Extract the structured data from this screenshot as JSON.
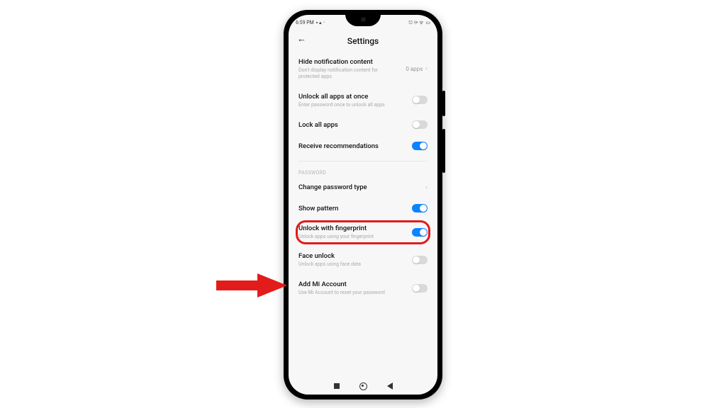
{
  "status": {
    "time": "6:59 PM",
    "icons_left": "▪ ▴ ··",
    "icons_right": "⎋ ⚞ ᯤ",
    "battery_icon": "▭"
  },
  "header": {
    "back_glyph": "←",
    "title": "Settings"
  },
  "rows": {
    "hide_notif": {
      "label": "Hide notification content",
      "sub": "Don't display notification content for protected apps",
      "count": "0 apps",
      "chev": "›"
    },
    "unlock_all": {
      "label": "Unlock all apps at once",
      "sub": "Enter password once to unlock all apps"
    },
    "lock_all": {
      "label": "Lock all apps"
    },
    "recommend": {
      "label": "Receive recommendations"
    },
    "section_password": "PASSWORD",
    "change_pw": {
      "label": "Change password type",
      "chev": "›"
    },
    "show_pattern": {
      "label": "Show pattern"
    },
    "fingerprint": {
      "label": "Unlock with fingerprint",
      "sub": "Unlock apps using your fingerprint"
    },
    "face": {
      "label": "Face unlock",
      "sub": "Unlock apps using face data"
    },
    "mi_account": {
      "label": "Add Mi Account",
      "sub": "Use Mi Account to reset your password"
    }
  },
  "toggles": {
    "unlock_all": false,
    "lock_all": false,
    "recommend": true,
    "show_pattern": true,
    "fingerprint": true,
    "face": false,
    "mi_account": false
  }
}
